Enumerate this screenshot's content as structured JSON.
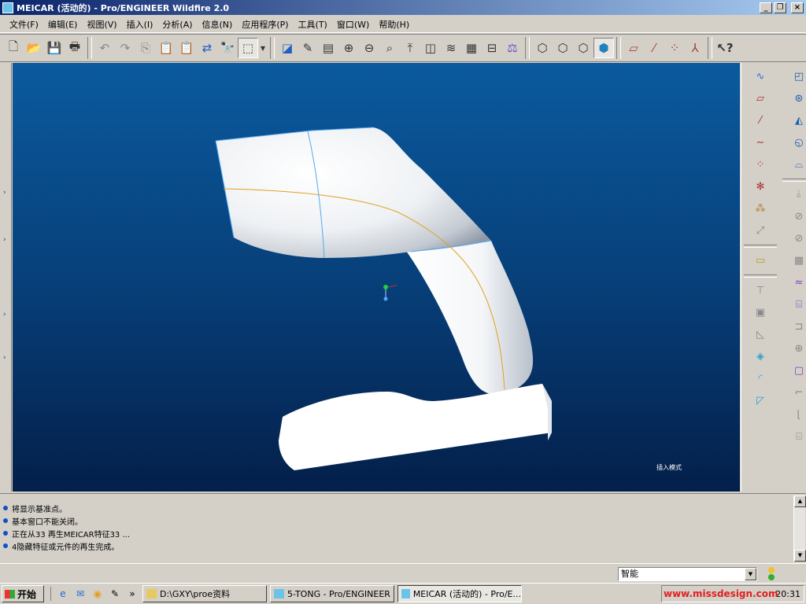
{
  "window": {
    "title": "MEICAR (活动的) - Pro/ENGINEER Wildfire 2.0",
    "buttons": [
      "_",
      "❐",
      "×"
    ]
  },
  "menu": [
    "文件(F)",
    "编辑(E)",
    "视图(V)",
    "插入(I)",
    "分析(A)",
    "信息(N)",
    "应用程序(P)",
    "工具(T)",
    "窗口(W)",
    "帮助(H)"
  ],
  "toolbar": {
    "icons": [
      "new-icon",
      "open-icon",
      "save-icon",
      "print-icon",
      "undo-icon",
      "redo-icon",
      "copy-icon",
      "paste-icon",
      "paste-special-icon",
      "regenerate-icon",
      "find-icon",
      "select-box-icon",
      "repaint-icon",
      "orient-icon",
      "saved-views-icon",
      "zoom-in-icon",
      "zoom-out-icon",
      "refit-icon",
      "spin-center-icon",
      "view-manager-icon",
      "layers-icon",
      "model-tree-icon",
      "measure-icon",
      "tolerance-icon",
      "wireframe-icon",
      "hidden-line-icon",
      "no-hidden-icon",
      "shading-icon",
      "datum-plane-display-icon",
      "datum-axis-display-icon",
      "datum-point-display-icon",
      "csys-display-icon",
      "context-help-icon"
    ]
  },
  "viewport": {
    "mode_label": "插入模式",
    "background_top": "#0b5a9e",
    "background_bottom": "#041f4a",
    "curve_color": "#e0a020",
    "edge_color": "#55a8f0"
  },
  "right_toolbar": {
    "col1_icons": [
      "datum-curve-sketch-icon",
      "datum-plane-icon",
      "datum-axis-icon",
      "datum-curve-icon",
      "datum-point-icon",
      "datum-point-offset-icon",
      "datum-point-field-icon",
      "csys-icon",
      "annotation-icon",
      "hole-icon",
      "shell-icon",
      "rib-icon",
      "draft-icon",
      "round-icon",
      "chamfer-icon"
    ],
    "col2_icons": [
      "extrude-icon",
      "revolve-icon",
      "variable-sweep-icon",
      "boundary-blend-icon",
      "style-icon",
      "mirror-icon",
      "merge-icon",
      "trim-icon",
      "pattern-icon",
      "offset-icon",
      "thicken-icon",
      "solidify-icon",
      "intersect-icon",
      "project-icon",
      "wrap-icon",
      "extend-icon",
      "flatten-icon"
    ]
  },
  "messages": [
    "将显示基准点。",
    "基本窗口不能关闭。",
    "正在从33 再生MEICAR特征33 ...",
    "4隐藏特征或元件的再生完成。"
  ],
  "status": {
    "filter_value": "智能"
  },
  "taskbar": {
    "start_label": "开始",
    "tasks": [
      "D:\\GXY\\proe资料",
      "5-TONG - Pro/ENGINEER",
      "MEICAR (活动的) - Pro/E..."
    ],
    "tray_watermark": "www.missdesign.com",
    "clock": "20:31"
  }
}
